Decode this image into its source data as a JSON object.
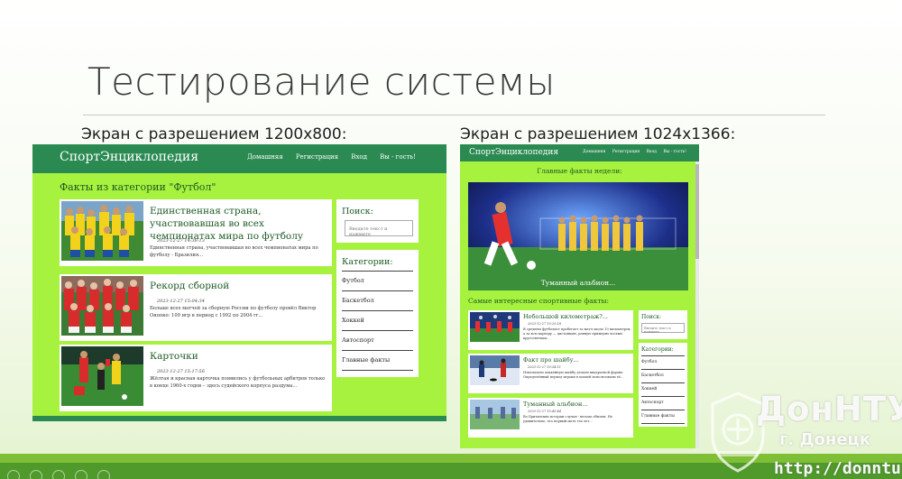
{
  "slide": {
    "title": "Тестирование системы",
    "caption_left": "Экран с разрешением 1200x800:",
    "caption_right": "Экран с разрешением 1024x1366:"
  },
  "site": {
    "brand": "СпортЭнциклопедия",
    "nav": [
      "Домашняя",
      "Регистрация",
      "Вход",
      "Вы - гость!"
    ],
    "search_title": "Поиск:",
    "search_placeholder": "Введите текст и нажмите",
    "categories_title": "Категории:",
    "categories": [
      "Футбол",
      "Баскетбол",
      "Хоккей",
      "Автоспорт",
      "Главные факты"
    ]
  },
  "desktop": {
    "heading": "Факты из категории \"Футбол\"",
    "posts": [
      {
        "title": "Единственная страна, участвовавшая во всех чемпионатах мира по футболу",
        "date": "2023-12-27 14:38:13",
        "text": "Единственная страна, участвовавшая во всех чемпионатах мира по футболу - Бразилия..."
      },
      {
        "title": "Рекорд сборной",
        "date": "2023-12-27 15:04:34",
        "text": "Больше всех матчей за сборную России по футболу провёл Виктор Онопко: 109 игр в период с 1992 по 2004 гг..."
      },
      {
        "title": "Карточки",
        "date": "2023-12-27 15:17:56",
        "text": "Жёлтая и красная карточка появились у футбольных арбитров только в конце 1960-х годов – здесь судейского корпуса раздума..."
      }
    ]
  },
  "tablet": {
    "week_heading": "Главные факты недели:",
    "hero_caption": "Туманный альбион...",
    "facts_heading": "Самые интересные спортивные факты:",
    "posts": [
      {
        "title": "Небольшой километраж?...",
        "date": "2023-12-27 15:25:18",
        "text": "В среднем футболист пробегает за матч около 10 километров, а за всю карьеру — дистанцию, равную примерно восьми кругосветкам..."
      },
      {
        "title": "Факт про шайбу...",
        "date": "2023-12-27 15:34:11",
        "text": "Изначально хоккейную шайбу делали квадратной формы. Определённый период игроки в хоккей использовали её..."
      },
      {
        "title": "Туманный альбион...",
        "date": "2023-12-27 15:45:44",
        "text": "Во Британских истории случая - весьма обычен. Не удивительно, что первый матч тех лет..."
      }
    ]
  },
  "watermark": {
    "name": "ДонНТУ",
    "city": "г. Донецк",
    "url": "http://donntu.ru"
  },
  "colors": {
    "site_bg": "#a7f23e",
    "site_nav": "#2b8a52",
    "heading_text": "#1d5a25",
    "band_light": "#7fbf35",
    "band_dark": "#4f9a2a"
  }
}
